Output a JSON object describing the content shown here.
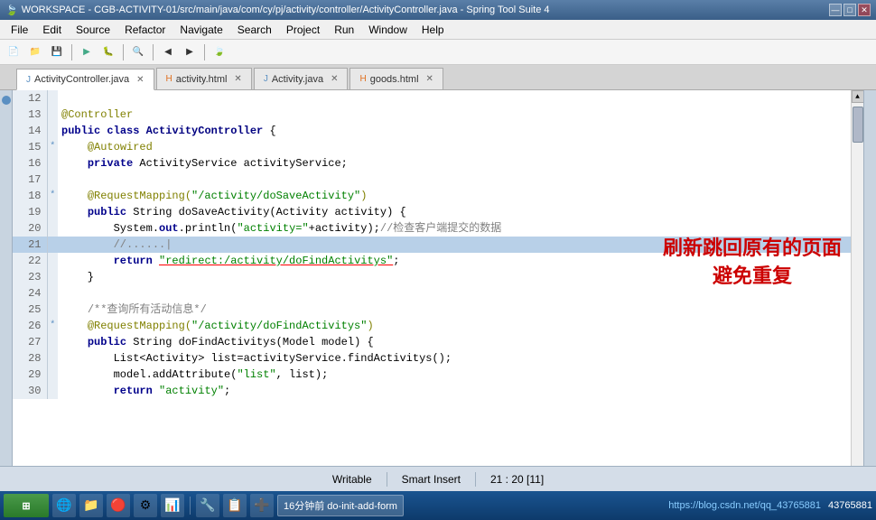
{
  "titlebar": {
    "title": "WORKSPACE - CGB-ACTIVITY-01/src/main/java/com/cy/pj/activity/controller/ActivityController.java - Spring Tool Suite 4",
    "controls": [
      "—",
      "□",
      "✕"
    ]
  },
  "menubar": {
    "items": [
      "File",
      "Edit",
      "Source",
      "Refactor",
      "Navigate",
      "Search",
      "Project",
      "Run",
      "Window",
      "Help"
    ]
  },
  "tabs": [
    {
      "label": "ActivityController.java",
      "active": true,
      "icon": "J"
    },
    {
      "label": "activity.html",
      "active": false,
      "icon": "H"
    },
    {
      "label": "Activity.java",
      "active": false,
      "icon": "J"
    },
    {
      "label": "goods.html",
      "active": false,
      "icon": "H"
    }
  ],
  "code": {
    "lines": [
      {
        "num": "12",
        "marker": "",
        "content": ""
      },
      {
        "num": "13",
        "marker": "",
        "content": "@Controller"
      },
      {
        "num": "14",
        "marker": "",
        "content": "public class ActivityController {"
      },
      {
        "num": "15",
        "marker": "*",
        "content": "    @Autowired"
      },
      {
        "num": "16",
        "marker": "",
        "content": "    private ActivityService activityService;"
      },
      {
        "num": "17",
        "marker": "",
        "content": ""
      },
      {
        "num": "18",
        "marker": "*",
        "content": "    @RequestMapping(\"/activity/doSaveActivity\")"
      },
      {
        "num": "19",
        "marker": "",
        "content": "    public String doSaveActivity(Activity activity) {"
      },
      {
        "num": "20",
        "marker": "",
        "content": "        System.out.println(\"activity=\"+activity);//检查客户端提交的数据"
      },
      {
        "num": "21",
        "marker": "",
        "content": "        //......|",
        "highlighted": true
      },
      {
        "num": "22",
        "marker": "",
        "content": "        return \"redirect:/activity/doFindActivitys\";"
      },
      {
        "num": "23",
        "marker": "",
        "content": "    }"
      },
      {
        "num": "24",
        "marker": "",
        "content": ""
      },
      {
        "num": "25",
        "marker": "",
        "content": "    /**查询所有活动信息*/"
      },
      {
        "num": "26",
        "marker": "*",
        "content": "    @RequestMapping(\"/activity/doFindActivitys\")"
      },
      {
        "num": "27",
        "marker": "",
        "content": "    public String doFindActivitys(Model model) {"
      },
      {
        "num": "28",
        "marker": "",
        "content": "        List<Activity> list=activityService.findActivitys();"
      },
      {
        "num": "29",
        "marker": "",
        "content": "        model.addAttribute(\"list\", list);"
      },
      {
        "num": "30",
        "marker": "",
        "content": "        return \"activity\";"
      }
    ]
  },
  "callout": {
    "line1": "刷新跳回原有的页面",
    "line2": "避免重复"
  },
  "statusbar": {
    "writable": "Writable",
    "insert_mode": "Smart Insert",
    "position": "21 : 20 [11]",
    "extra": ""
  },
  "taskbar": {
    "start_label": "Start",
    "app_label": "16分钟前 do-init-add-form",
    "url": "https://blog.csdn.net/qq_43765881",
    "icons": [
      "🌐",
      "📁",
      "📊",
      "⚙️",
      "📧",
      "🔧",
      "📋",
      "➕"
    ]
  }
}
